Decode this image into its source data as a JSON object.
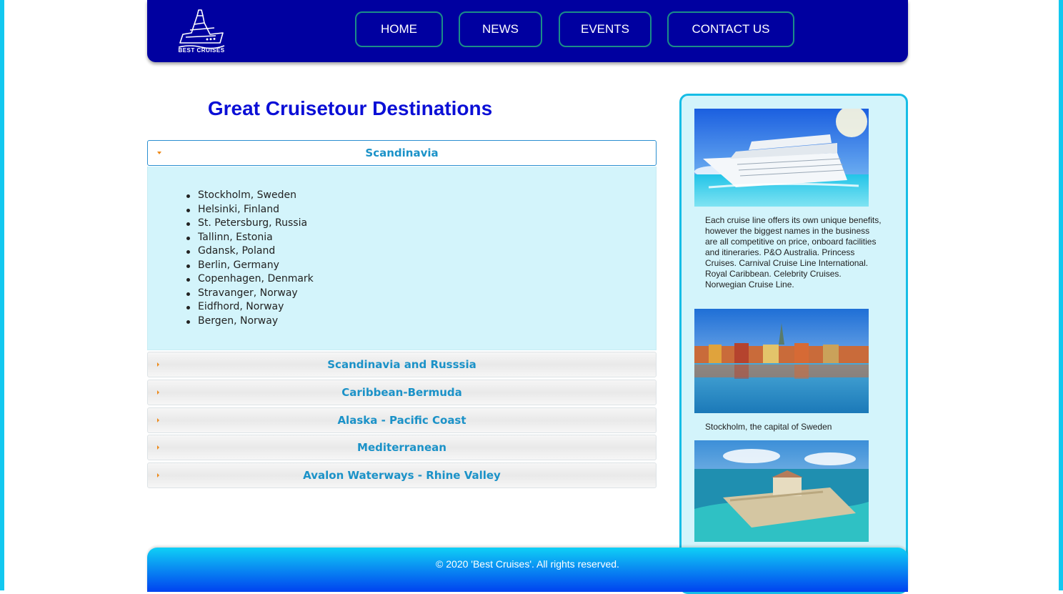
{
  "brand": {
    "logo_text": "BEST CRUISES"
  },
  "nav": {
    "home": "HOME",
    "news": "NEWS",
    "events": "EVENTS",
    "contact": "CONTACT US"
  },
  "main": {
    "title": "Great Cruisetour Destinations",
    "accordion": [
      {
        "label": "Scandinavia",
        "expanded": true,
        "items": [
          "Stockholm, Sweden",
          "Helsinki, Finland",
          "St. Petersburg, Russia",
          "Tallinn, Estonia",
          "Gdansk, Poland",
          "Berlin, Germany",
          "Copenhagen, Denmark",
          "Stravanger, Norway",
          "Eidfhord, Norway",
          "Bergen, Norway"
        ]
      },
      {
        "label": "Scandinavia and Russsia",
        "expanded": false
      },
      {
        "label": "Caribbean-Bermuda",
        "expanded": false
      },
      {
        "label": "Alaska - Pacific Coast",
        "expanded": false
      },
      {
        "label": "Mediterranean",
        "expanded": false
      },
      {
        "label": "Avalon Waterways - Rhine Valley",
        "expanded": false
      }
    ]
  },
  "sidebar": {
    "intro_text": "Each cruise line offers its own unique benefits, however the biggest names in the business are all competitive on price, onboard facilities and itineraries. P&O Australia. Princess Cruises. Carnival Cruise Line International. Royal Caribbean. Celebrity Cruises. Norwegian Cruise Line.",
    "photo2_caption": "Stockholm, the capital of Sweden"
  },
  "footer": {
    "copyright": "© 2020 'Best Cruises'. All rights reserved."
  },
  "colors": {
    "header_bg": "#0000a0",
    "title": "#0b0fd6",
    "accordion_text": "#1b92c8",
    "panel_bg": "#d3f4fb",
    "sidebar_border": "#16bde6",
    "caret": "#ee8a1a"
  }
}
